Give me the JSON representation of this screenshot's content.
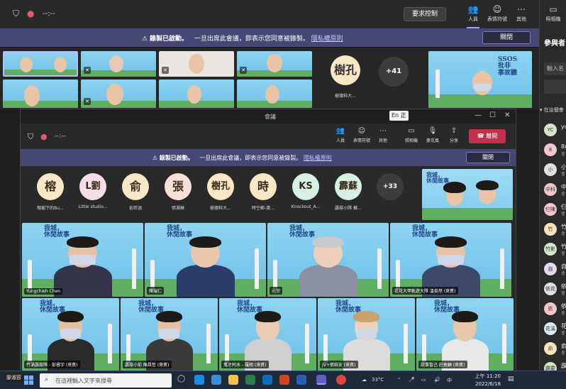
{
  "bg_toolbar": {
    "timer": "--:--",
    "request_control": "要求控制",
    "items": [
      {
        "label": "人員",
        "icon": "people-icon"
      },
      {
        "label": "表情符號",
        "icon": "emoji-icon"
      },
      {
        "label": "其他",
        "icon": "more-icon"
      },
      {
        "label": "照相機",
        "icon": "camera-icon"
      }
    ]
  },
  "recording_banner": {
    "title": "錄製已啟動。",
    "message": "一旦出席此會議，即表示您同意被錄製。",
    "link": "隱私權原則",
    "close": "關閉"
  },
  "bg_grid": {
    "avatar_initials": "樹孔",
    "avatar_name": "樹德科大...",
    "more_count": "+41",
    "hosts_logo": "SSOS\n批非\n事故聽"
  },
  "panel": {
    "title": "參與者",
    "search_placeholder": "輸入名",
    "section": "在這個會",
    "rows": [
      {
        "initials": "YC",
        "name": "yu",
        "sub": "",
        "color": "#d3e7c9"
      },
      {
        "initials": "8",
        "name": "8ε",
        "sub": "會",
        "color": "#f6c6d0"
      },
      {
        "initials": "小",
        "name": "小",
        "sub": "會",
        "color": "#e0e0e0"
      },
      {
        "initials": "中科",
        "name": "中",
        "sub": "會",
        "color": "#f4c7c7"
      },
      {
        "initials": "仨陳",
        "name": "仨",
        "sub": "會",
        "color": "#f6c6d0"
      },
      {
        "initials": "竹",
        "name": "竹",
        "sub": "會",
        "color": "#f9e3b8"
      },
      {
        "initials": "竹影",
        "name": "竹",
        "sub": "會",
        "color": "#d3e7c9"
      },
      {
        "initials": "自",
        "name": "自",
        "sub": "會",
        "color": "#e3d7f2"
      },
      {
        "initials": "依花",
        "name": "依",
        "sub": "會",
        "color": "#e0e0e0"
      },
      {
        "initials": "依",
        "name": "依",
        "sub": "會",
        "color": "#f4c7c7"
      },
      {
        "initials": "花溪",
        "name": "花",
        "sub": "會",
        "color": "#d9ebf7"
      },
      {
        "initials": "俞",
        "name": "俞",
        "sub": "會",
        "color": "#f9e3b8"
      },
      {
        "initials": "霹靂",
        "name": "霹",
        "sub": "會",
        "color": "#d3e7c9"
      }
    ]
  },
  "fg_window": {
    "title": "會議",
    "ime": "En 正",
    "timer": "--:--",
    "items": [
      {
        "label": "人員",
        "icon": "people-icon"
      },
      {
        "label": "表情符號",
        "icon": "emoji-icon"
      },
      {
        "label": "其他",
        "icon": "more-icon"
      },
      {
        "label": "照相機",
        "icon": "camera-icon"
      },
      {
        "label": "麥克風",
        "icon": "microphone-icon"
      },
      {
        "label": "分享",
        "icon": "share-icon"
      }
    ],
    "leave": "離開",
    "avatars": [
      {
        "initials": "榕",
        "name": "榕樹下的Bu...",
        "color": "#f8e7c4"
      },
      {
        "initials": "L劉",
        "name": "Little studio...",
        "color": "#f6dbe8"
      },
      {
        "initials": "俞",
        "name": "俞昕涵",
        "color": "#f8e7c4"
      },
      {
        "initials": "張",
        "name": "張湘琳",
        "color": "#f8e0d6"
      },
      {
        "initials": "樹孔",
        "name": "樹德科大...",
        "color": "#f8e7c4"
      },
      {
        "initials": "時",
        "name": "時空郵-黃...",
        "color": "#f8e7c4"
      },
      {
        "initials": "KS",
        "name": "Knockout_A...",
        "color": "#d6f0e4"
      },
      {
        "initials": "霹蘇",
        "name": "霹靂小隊 蘇...",
        "color": "#d6f0e4"
      }
    ],
    "more_count": "+33",
    "tiles": [
      {
        "name": "Yungchieh Chen"
      },
      {
        "name": "陳瑞仁"
      },
      {
        "name": "元宗"
      },
      {
        "name": "花花大甲軌遊大隊 溫俊然 (來賓)"
      },
      {
        "name": "竹涌霹靂隊 - 彭睿宇 (來賓)"
      },
      {
        "name": "霹靂小前 陳昌哲 (來賓)"
      },
      {
        "name": "鬼才阿水 - 羅翔 (來賓)"
      },
      {
        "name": "JV+張鈺安 (來賓)"
      },
      {
        "name": "說事暫己 莊敦顧 (來賓)"
      }
    ],
    "tile_logo": "我城，\n休閒故事"
  },
  "taskbar": {
    "user": "廖淑容",
    "search_placeholder": "在這裡輸入文字來搜尋",
    "temperature": "33°C",
    "time": "上午 11:20",
    "date": "2022/6/18"
  }
}
